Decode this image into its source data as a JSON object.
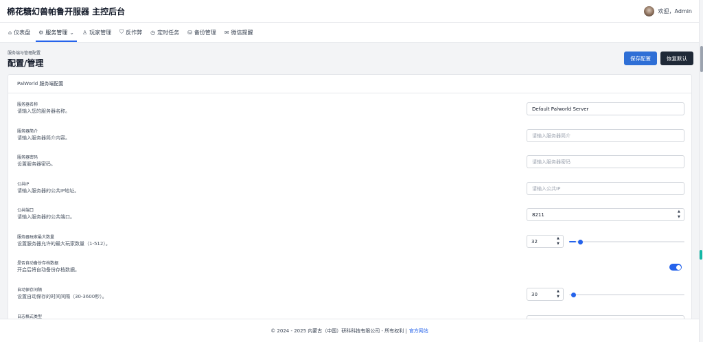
{
  "header": {
    "brand": "棉花糖幻兽帕鲁开服器 主控后台",
    "user_greeting": "欢迎，Admin"
  },
  "nav": [
    {
      "icon": "home-icon",
      "glyph": "⌂",
      "label": "仪表盘"
    },
    {
      "icon": "gear-icon",
      "glyph": "⚙",
      "label": "服务管理",
      "caret": "⌄",
      "active": true
    },
    {
      "icon": "user-icon",
      "glyph": "♙",
      "label": "玩家管理"
    },
    {
      "icon": "shield-icon",
      "glyph": "⛉",
      "label": "反作弊"
    },
    {
      "icon": "clock-icon",
      "glyph": "◷",
      "label": "定时任务"
    },
    {
      "icon": "database-icon",
      "glyph": "⛁",
      "label": "备份管理"
    },
    {
      "icon": "chat-icon",
      "glyph": "✉",
      "label": "微信提醒"
    }
  ],
  "page": {
    "breadcrumb": "服务端与管理配置",
    "title": "配置/管理",
    "save_label": "保存配置",
    "reset_label": "恢复默认"
  },
  "card": {
    "title": "PalWorld 服务端配置",
    "fields": [
      {
        "label": "服务器名称",
        "desc": "请输入您的服务器名称。",
        "type": "text",
        "value": "Default Palworld Server",
        "placeholder": ""
      },
      {
        "label": "服务器简介",
        "desc": "请输入服务器简介内容。",
        "type": "text",
        "value": "",
        "placeholder": "请输入服务器简介"
      },
      {
        "label": "服务器密码",
        "desc": "设置服务器密码。",
        "type": "text",
        "value": "",
        "placeholder": "请输入服务器密码"
      },
      {
        "label": "公共IP",
        "desc": "请输入服务器的公共IP地址。",
        "type": "text",
        "value": "",
        "placeholder": "请输入公共IP"
      },
      {
        "label": "公共端口",
        "desc": "请输入服务器的公共端口。",
        "type": "number",
        "value": "8211"
      },
      {
        "label": "服务器玩家最大数量",
        "desc": "设置服务器允许的最大玩家数量（1-512）。",
        "type": "slider",
        "value": "32",
        "min": 1,
        "max": 512,
        "level": 32
      },
      {
        "label": "是否自动备份存档数据",
        "desc": "开启后将自动备份存档数据。",
        "type": "toggle",
        "on": true
      },
      {
        "label": "自动保存间隔",
        "desc": "设置自动保存的时间间隔（30-3600秒）。",
        "type": "slider",
        "value": "30",
        "min": 30,
        "max": 3600,
        "level": 30
      },
      {
        "label": "日志格式类型",
        "desc": "",
        "type": "select",
        "value": ""
      }
    ]
  },
  "footer": {
    "text": "© 2024 - 2025 内蒙古（中国）研科科技有限公司 - 所有权利 |",
    "link": "官方网站"
  },
  "colors": {
    "accent": "#2563eb",
    "dark_button": "#1f2937",
    "save_button": "#2f6fd6"
  }
}
